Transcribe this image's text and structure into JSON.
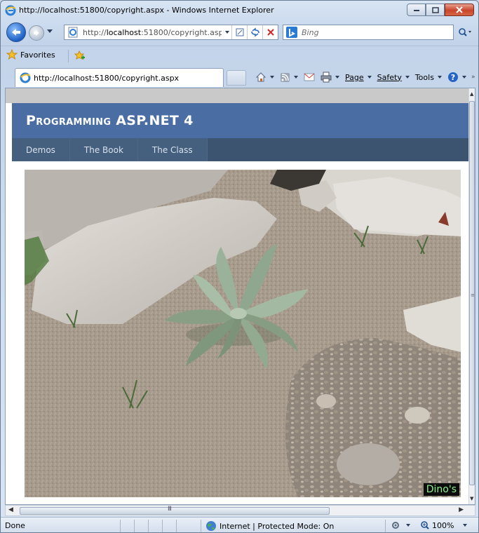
{
  "window": {
    "title": "http://localhost:51800/copyright.aspx - Windows Internet Explorer"
  },
  "address_bar": {
    "url_prefix": "http://",
    "url_host": "localhost",
    "url_rest": ":51800/copyright.asp"
  },
  "search": {
    "placeholder": "Bing"
  },
  "favorites_bar": {
    "favorites_label": "Favorites"
  },
  "tab": {
    "label": "http://localhost:51800/copyright.aspx"
  },
  "command_bar": {
    "page_label": "Page",
    "safety_label": "Safety",
    "tools_label": "Tools"
  },
  "site": {
    "title": "Programming ASP.NET 4",
    "menu": [
      {
        "label": "Demos"
      },
      {
        "label": "The Book"
      },
      {
        "label": "The Class"
      }
    ],
    "photo_badge": "Dino's"
  },
  "status_bar": {
    "status": "Done",
    "zone": "Internet | Protected Mode: On",
    "zoom": "100%"
  },
  "colors": {
    "site_header": "#4a6da4",
    "site_nav": "#3c5470",
    "badge_text": "#8ef08c"
  }
}
